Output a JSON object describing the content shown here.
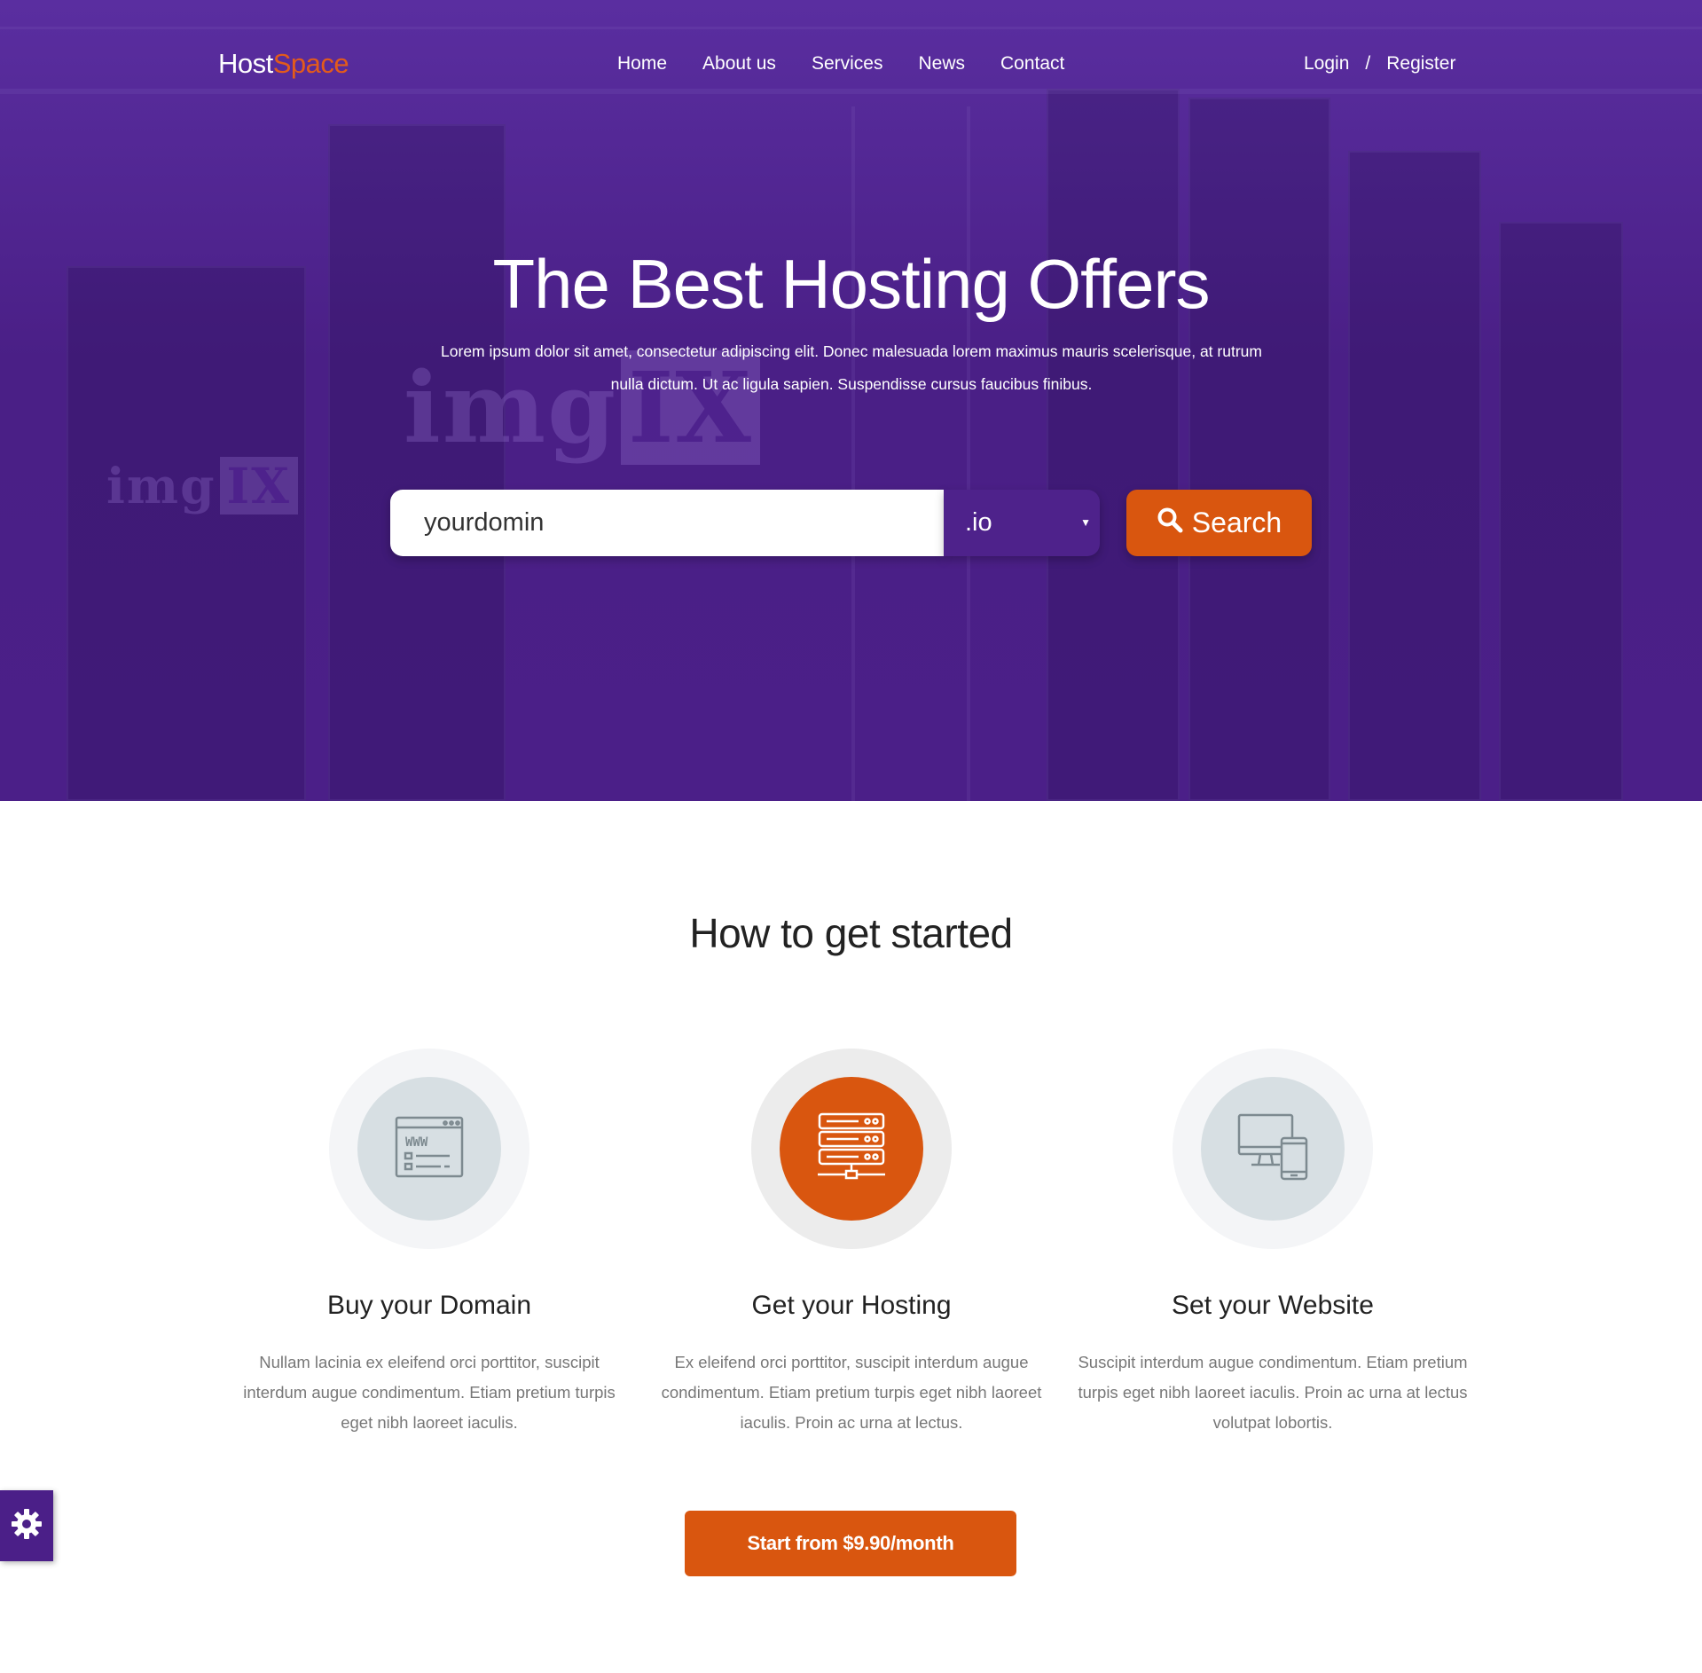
{
  "brand": {
    "part1": "Host",
    "part2": "Space"
  },
  "nav": {
    "items": [
      "Home",
      "About us",
      "Services",
      "News",
      "Contact"
    ]
  },
  "auth": {
    "login": "Login",
    "separator": "/",
    "register": "Register"
  },
  "hero": {
    "title": "The Best Hosting Offers",
    "subtitle": "Lorem ipsum dolor sit amet, consectetur adipiscing elit. Donec malesuada lorem maximus mauris scelerisque, at rutrum nulla dictum. Ut ac ligula sapien. Suspendisse cursus faucibus finibus.",
    "watermark_a": "img",
    "watermark_b": "IX"
  },
  "search": {
    "input_value": "yourdomin",
    "tld_selected": ".io",
    "button_label": "Search",
    "button_icon": "search-icon"
  },
  "section": {
    "title": "How to get started",
    "steps": [
      {
        "icon": "www-browser-icon",
        "title": "Buy your Domain",
        "text": "Nullam lacinia ex eleifend orci porttitor, suscipit interdum augue condimentum. Etiam pretium turpis eget nibh laoreet iaculis."
      },
      {
        "icon": "server-rack-icon",
        "title": "Get your Hosting",
        "text": "Ex eleifend orci porttitor, suscipit interdum augue condimentum. Etiam pretium turpis eget nibh laoreet iaculis. Proin ac urna at lectus."
      },
      {
        "icon": "devices-icon",
        "title": "Set your Website",
        "text": "Suscipit interdum augue condimentum. Etiam pretium turpis eget nibh laoreet iaculis. Proin ac urna at lectus volutpat lobortis."
      }
    ],
    "cta_label": "Start from $9.90/month"
  },
  "settings_icon": "gear-icon",
  "colors": {
    "hero_purple": "#4b1f88",
    "accent_orange": "#d9560f",
    "text_dark": "#222222",
    "text_muted": "#777777"
  }
}
